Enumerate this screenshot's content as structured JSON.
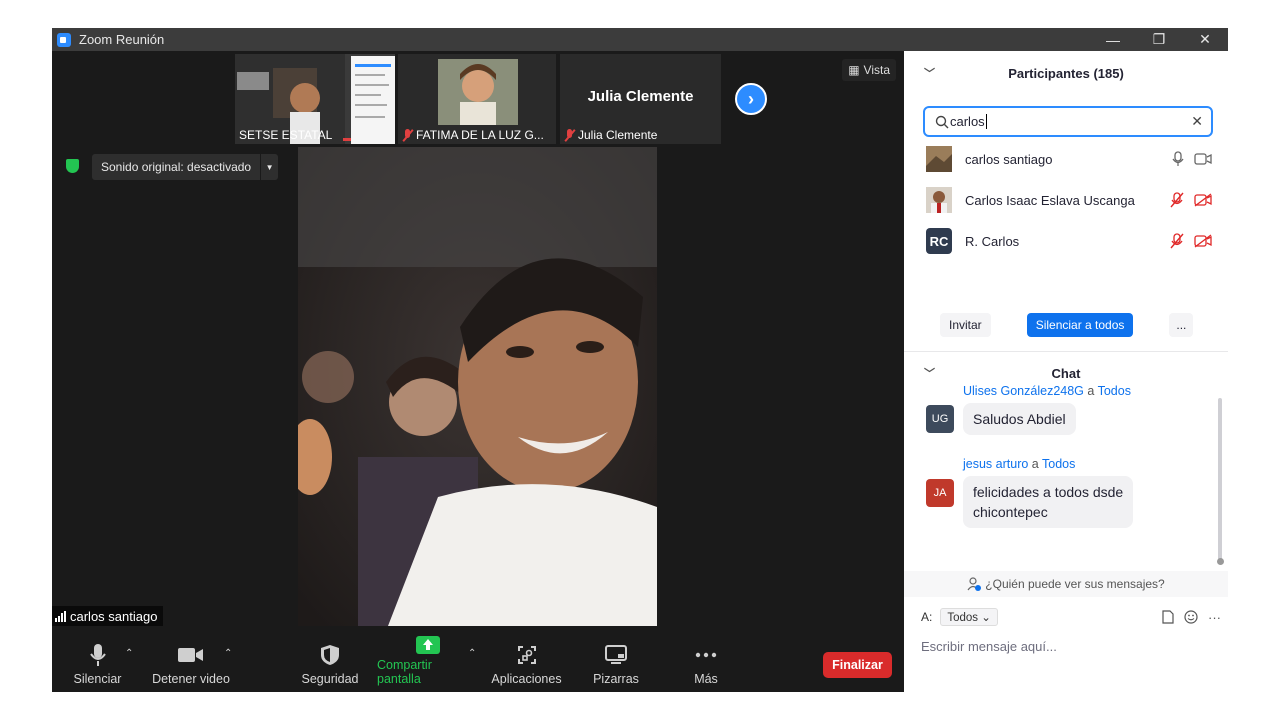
{
  "window": {
    "title": "Zoom Reunión",
    "minimize": "—",
    "restore": "❐",
    "close": "✕"
  },
  "thumbnails": [
    {
      "name": "SETSE ESTATAL",
      "muted": false
    },
    {
      "name": "FATIMA DE LA LUZ G...",
      "muted": true
    },
    {
      "name": "Julia Clemente",
      "muted": true,
      "display_name": "Julia Clemente"
    }
  ],
  "next_icon": "chevron-right-icon",
  "vista_label": "Vista",
  "sound_label": "Sonido original: desactivado",
  "active_speaker": "carlos santiago",
  "toolbar": {
    "mute": "Silenciar",
    "video": "Detener video",
    "security": "Seguridad",
    "share": "Compartir pantalla",
    "apps": "Aplicaciones",
    "whiteboards": "Pizarras",
    "more": "Más",
    "end": "Finalizar"
  },
  "participants": {
    "title": "Participantes (185)",
    "search_value": "carlos",
    "list": [
      {
        "name": "carlos santiago",
        "mic": "on",
        "video": "on",
        "avatar": "photo"
      },
      {
        "name": "Carlos Isaac Eslava Uscanga",
        "mic": "off",
        "video": "off",
        "avatar": "photo"
      },
      {
        "name": "R. Carlos",
        "mic": "off",
        "video": "off",
        "avatar": "RC"
      }
    ],
    "invite": "Invitar",
    "mute_all": "Silenciar a todos",
    "more": "..."
  },
  "chat": {
    "title": "Chat",
    "messages": [
      {
        "from": "Ulises González248G",
        "to_word": "a",
        "to": "Todos",
        "initials": "UG",
        "color": "#3d4a5c",
        "text": "Saludos Abdiel"
      },
      {
        "from": "jesus arturo",
        "to_word": "a",
        "to": "Todos",
        "initials": "JA",
        "color": "#c0392b",
        "text_line1": "felicidades a todos dsde",
        "text_line2": "chicontepec"
      }
    ],
    "who_can_see": "¿Quién puede ver sus mensajes?",
    "to_label": "A:",
    "to_value": "Todos",
    "placeholder": "Escribir mensaje aquí..."
  }
}
